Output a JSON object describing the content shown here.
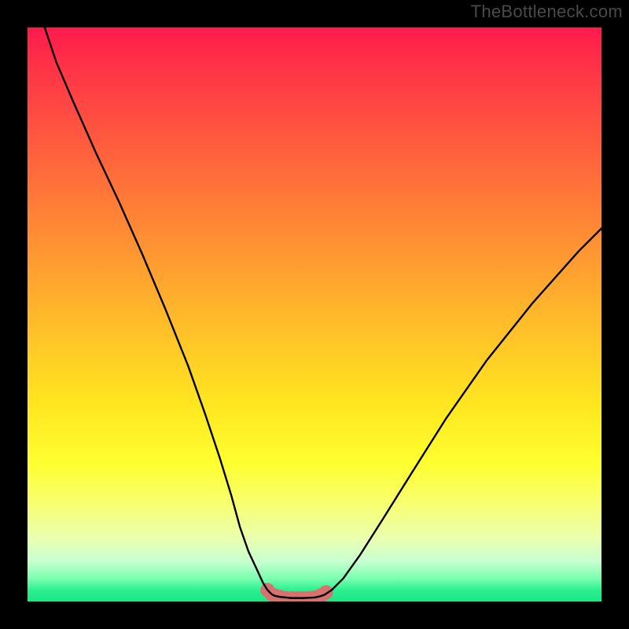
{
  "watermark": "TheBottleneck.com",
  "chart_data": {
    "type": "line",
    "title": "",
    "xlabel": "",
    "ylabel": "",
    "xlim": [
      0,
      100
    ],
    "ylim": [
      0,
      100
    ],
    "series": [
      {
        "name": "bottleneck-curve",
        "x": [
          3,
          5,
          8,
          12,
          16,
          20,
          24,
          28,
          31,
          33.5,
          35.5,
          37,
          38.5,
          40,
          41,
          41.8,
          42.5,
          43,
          44,
          46,
          48,
          50,
          51,
          51.8,
          53,
          55,
          58,
          62,
          67,
          73,
          80,
          88,
          96,
          100
        ],
        "y": [
          100,
          94,
          87,
          78,
          69.5,
          60.5,
          51,
          41,
          32.5,
          25,
          18.5,
          13,
          8.7,
          5.5,
          3.3,
          2,
          1.3,
          1,
          0.8,
          0.6,
          0.6,
          0.7,
          0.9,
          1.2,
          2,
          4,
          8.2,
          14.5,
          22.5,
          32,
          42,
          52,
          61,
          65
        ]
      },
      {
        "name": "bottom-dots",
        "x": [
          41.8,
          42.5,
          43.2,
          44,
          45,
          46,
          47,
          48,
          49,
          50,
          50.8,
          51.4,
          52
        ],
        "y": [
          2.0,
          1.3,
          1.0,
          0.8,
          0.6,
          0.55,
          0.55,
          0.55,
          0.6,
          0.7,
          0.9,
          1.2,
          1.6
        ]
      }
    ],
    "colors": {
      "curve": "#000000",
      "dots": "#d87070"
    }
  }
}
